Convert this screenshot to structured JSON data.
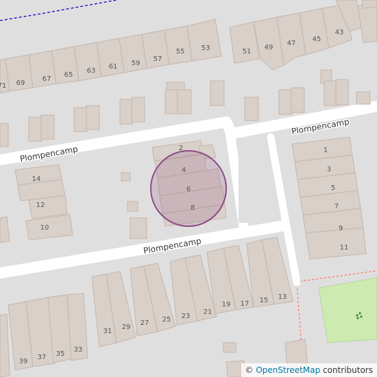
{
  "map": {
    "street_labels": [
      "Plompencamp",
      "Plompencamp",
      "Plompencamp"
    ],
    "house_numbers_north": [
      "71",
      "69",
      "67",
      "65",
      "63",
      "61",
      "59",
      "57",
      "55",
      "53",
      "51",
      "49",
      "47",
      "45",
      "43"
    ],
    "house_numbers_center": [
      "2",
      "4",
      "6",
      "8"
    ],
    "house_numbers_west": [
      "14",
      "12",
      "10"
    ],
    "house_numbers_east": [
      "1",
      "3",
      "5",
      "7",
      "9",
      "11"
    ],
    "house_numbers_south": [
      "39",
      "37",
      "35",
      "33",
      "31",
      "29",
      "27",
      "25",
      "23",
      "21",
      "19",
      "17",
      "15",
      "13"
    ],
    "colors": {
      "background": "#e0dfdf",
      "building": "#d9d0c9",
      "building_stroke": "#c4b6ab",
      "road": "#ffffff",
      "park": "#cdebb0",
      "marker": "#8c4b82",
      "path": "#fa8072",
      "boundary": "#0000cc"
    }
  },
  "attribution": {
    "symbol": "©",
    "link_text": "OpenStreetMap",
    "suffix": "contributors"
  }
}
